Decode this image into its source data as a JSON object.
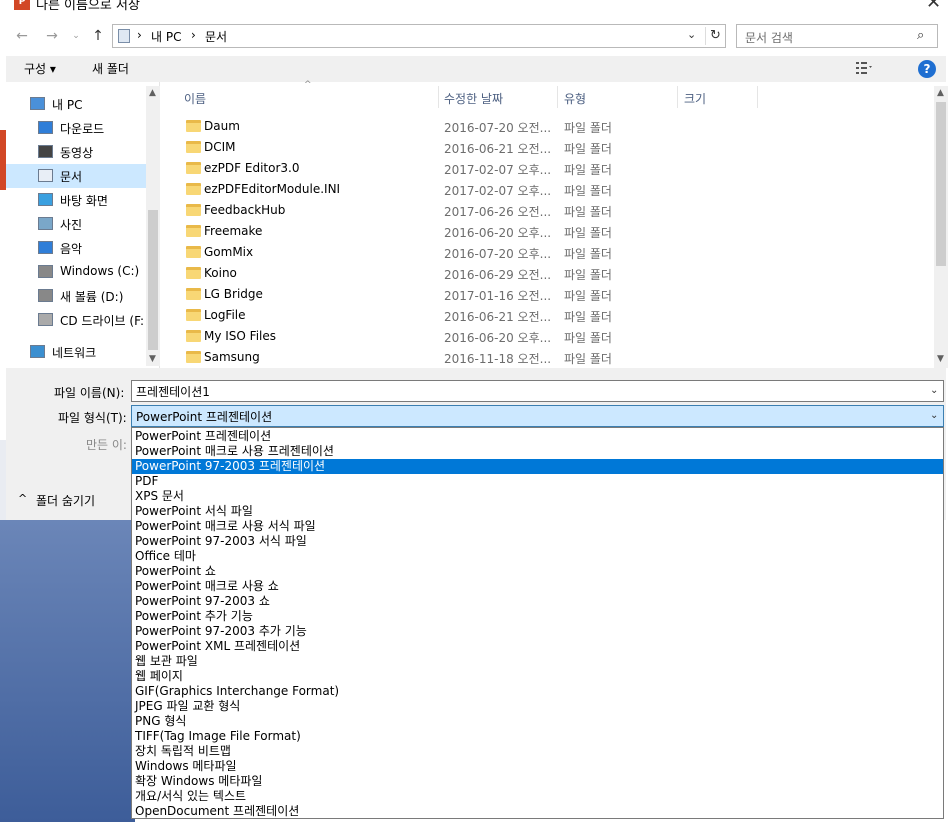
{
  "window": {
    "title": "다른 이름으로 저장",
    "app_icon_text": "P"
  },
  "address": {
    "root": "내 PC",
    "current": "문서"
  },
  "search": {
    "placeholder": "문서 검색"
  },
  "toolbar": {
    "organize": "구성 ▾",
    "new_folder": "새 폴더",
    "help": "?"
  },
  "sidebar": {
    "items": [
      {
        "label": "내 PC",
        "icon": "computer-icon"
      },
      {
        "label": "다운로드",
        "icon": "download-icon"
      },
      {
        "label": "동영상",
        "icon": "video-icon"
      },
      {
        "label": "문서",
        "icon": "document-icon",
        "selected": true
      },
      {
        "label": "바탕 화면",
        "icon": "desktop-icon"
      },
      {
        "label": "사진",
        "icon": "pictures-icon"
      },
      {
        "label": "음악",
        "icon": "music-icon"
      },
      {
        "label": "Windows (C:)",
        "icon": "drive-icon"
      },
      {
        "label": "새 볼륨 (D:)",
        "icon": "drive-icon"
      },
      {
        "label": "CD 드라이브 (F:",
        "icon": "cd-drive-icon"
      },
      {
        "label": "네트워크",
        "icon": "network-icon"
      }
    ]
  },
  "columns": {
    "name": "이름",
    "date": "수정한 날짜",
    "type": "유형",
    "size": "크기"
  },
  "files": [
    {
      "name": "Daum",
      "date": "2016-07-20 오전...",
      "type": "파일 폴더"
    },
    {
      "name": "DCIM",
      "date": "2016-06-21 오전...",
      "type": "파일 폴더"
    },
    {
      "name": "ezPDF Editor3.0",
      "date": "2017-02-07 오후...",
      "type": "파일 폴더"
    },
    {
      "name": "ezPDFEditorModule.INI",
      "date": "2017-02-07 오후...",
      "type": "파일 폴더"
    },
    {
      "name": "FeedbackHub",
      "date": "2017-06-26 오전...",
      "type": "파일 폴더"
    },
    {
      "name": "Freemake",
      "date": "2016-06-20 오후...",
      "type": "파일 폴더"
    },
    {
      "name": "GomMix",
      "date": "2016-07-20 오후...",
      "type": "파일 폴더"
    },
    {
      "name": "Koino",
      "date": "2016-06-29 오전...",
      "type": "파일 폴더"
    },
    {
      "name": "LG Bridge",
      "date": "2017-01-16 오전...",
      "type": "파일 폴더"
    },
    {
      "name": "LogFile",
      "date": "2016-06-21 오전...",
      "type": "파일 폴더"
    },
    {
      "name": "My ISO Files",
      "date": "2016-06-20 오후...",
      "type": "파일 폴더"
    },
    {
      "name": "Samsung",
      "date": "2016-11-18 오전...",
      "type": "파일 폴더"
    }
  ],
  "form": {
    "filename_label": "파일 이름(N):",
    "filename_value": "프레젠테이션1",
    "filetype_label": "파일 형식(T):",
    "filetype_value": "PowerPoint 프레젠테이션",
    "author_label": "만든 이:",
    "hide_folders": "폴더 숨기기"
  },
  "filetype_options": [
    "PowerPoint 프레젠테이션",
    "PowerPoint 매크로 사용 프레젠테이션",
    "PowerPoint 97-2003 프레젠테이션",
    "PDF",
    "XPS 문서",
    "PowerPoint 서식 파일",
    "PowerPoint 매크로 사용 서식 파일",
    "PowerPoint 97-2003 서식 파일",
    "Office 테마",
    "PowerPoint 쇼",
    "PowerPoint 매크로 사용 쇼",
    "PowerPoint 97-2003 쇼",
    "PowerPoint 추가 기능",
    "PowerPoint 97-2003 추가 기능",
    "PowerPoint XML 프레젠테이션",
    "웹 보관 파일",
    "웹 페이지",
    "GIF(Graphics Interchange Format)",
    "JPEG 파일 교환 형식",
    "PNG 형식",
    "TIFF(Tag Image File Format)",
    "장치 독립적 비트맵",
    "Windows 메타파일",
    "확장 Windows 메타파일",
    "개요/서식 있는 텍스트",
    "OpenDocument 프레젠테이션"
  ],
  "selected_option_index": 2,
  "colors": {
    "selection": "#0078d7",
    "accent": "#cce8ff",
    "folder": "#f8d775"
  }
}
